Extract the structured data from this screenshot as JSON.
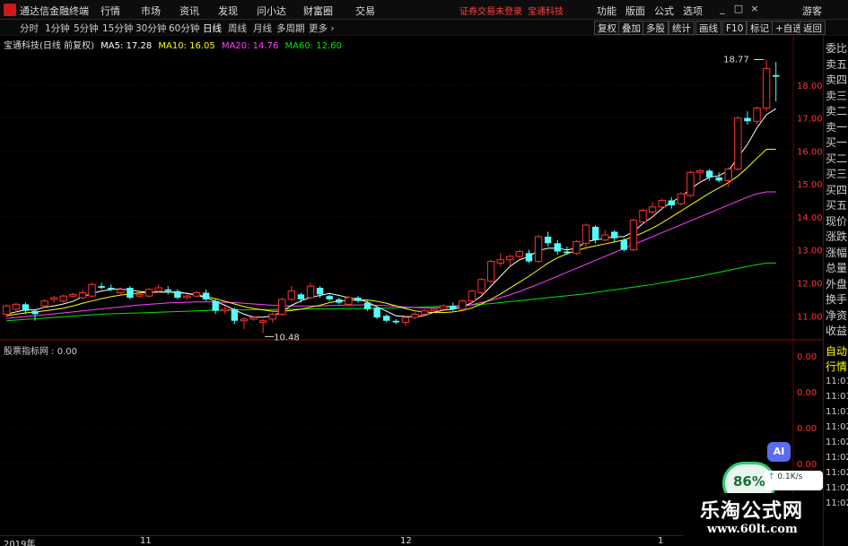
{
  "app": {
    "title": "通达信金融终端",
    "menus": [
      "行情",
      "市场",
      "资讯",
      "发现",
      "问小达",
      "财富圈",
      "交易"
    ],
    "alert": "证券交易未登录",
    "alert_stock": "宝通科技",
    "right_menus": [
      "功能",
      "版面",
      "公式",
      "选项"
    ],
    "user": "游客",
    "window_buttons": [
      "_",
      "□",
      "×"
    ]
  },
  "tabs": [
    "分时",
    "1分钟",
    "5分钟",
    "15分钟",
    "30分钟",
    "60分钟",
    "日线",
    "周线",
    "月线",
    "多周期",
    "更多 ›"
  ],
  "active_tab": "日线",
  "toolbar_right": [
    "复权",
    "叠加",
    "多股",
    "统计",
    "画线",
    "F10",
    "标记",
    "+自选",
    "返回"
  ],
  "legend": {
    "stock": "宝通科技(日线 前复权)",
    "ma5": "MA5: 17.28",
    "ma10": "MA10: 16.05",
    "ma20": "MA20: 14.76",
    "ma60": "MA60: 12.60"
  },
  "colors": {
    "up": "#ff3232",
    "down": "#54fcfc",
    "ma5": "#ffffff",
    "ma10": "#ffff00",
    "ma20": "#ff40ff",
    "ma60": "#00e600",
    "grid": "#700000",
    "axis_text": "#ff3232"
  },
  "price_axis": [
    "18.00",
    "17.00",
    "16.00",
    "15.00",
    "14.00",
    "13.00",
    "12.00",
    "11.00"
  ],
  "annotations": {
    "high": "18.77",
    "low": "10.48"
  },
  "indicator": {
    "legend": "股票指标网 : 0.00",
    "axis": [
      "0.00",
      "0.00",
      "0.00",
      "0.00"
    ]
  },
  "quote_panel": {
    "labels": [
      "委比",
      "卖五",
      "卖四",
      "卖三",
      "卖二",
      "卖一",
      "买一",
      "买二",
      "买三",
      "买四",
      "买五",
      "现价",
      "涨跌",
      "涨幅",
      "总量",
      "外盘",
      "换手",
      "净资",
      "收益"
    ],
    "lower": [
      "自动",
      "行情",
      "11:01",
      "11:01",
      "11:01",
      "11:02",
      "11:02",
      "11:02",
      "11:02",
      "11:02",
      "11:02"
    ]
  },
  "date_axis": [
    "2019年",
    "11",
    "12",
    "1"
  ],
  "widgets": {
    "ai": "AI",
    "pct": "86%",
    "speed": "0.1K/s"
  },
  "watermark": {
    "line1": "乐淘公式网",
    "line2": "www.60lt.com"
  },
  "chart_data": {
    "type": "candlestick",
    "ylim": [
      10.3,
      19.0
    ],
    "yticks": [
      11,
      12,
      13,
      14,
      15,
      16,
      17,
      18
    ],
    "candles": [
      {
        "o": 11.05,
        "c": 11.3,
        "h": 11.35,
        "l": 10.95
      },
      {
        "o": 11.2,
        "c": 11.35,
        "h": 11.4,
        "l": 11.1
      },
      {
        "o": 11.35,
        "c": 11.15,
        "h": 11.4,
        "l": 11.05
      },
      {
        "o": 11.15,
        "c": 11.05,
        "h": 11.2,
        "l": 10.85
      },
      {
        "o": 11.3,
        "c": 11.45,
        "h": 11.5,
        "l": 11.25
      },
      {
        "o": 11.5,
        "c": 11.55,
        "h": 11.6,
        "l": 11.4
      },
      {
        "o": 11.45,
        "c": 11.6,
        "h": 11.65,
        "l": 11.4
      },
      {
        "o": 11.6,
        "c": 11.65,
        "h": 11.7,
        "l": 11.55
      },
      {
        "o": 11.55,
        "c": 11.7,
        "h": 11.8,
        "l": 11.5
      },
      {
        "o": 11.6,
        "c": 11.95,
        "h": 12.0,
        "l": 11.55
      },
      {
        "o": 11.9,
        "c": 11.85,
        "h": 12.0,
        "l": 11.8
      },
      {
        "o": 11.85,
        "c": 11.8,
        "h": 11.95,
        "l": 11.75
      },
      {
        "o": 11.7,
        "c": 11.8,
        "h": 11.85,
        "l": 11.6
      },
      {
        "o": 11.85,
        "c": 11.55,
        "h": 11.9,
        "l": 11.5
      },
      {
        "o": 11.6,
        "c": 11.65,
        "h": 11.7,
        "l": 11.55
      },
      {
        "o": 11.6,
        "c": 11.8,
        "h": 11.85,
        "l": 11.55
      },
      {
        "o": 11.75,
        "c": 11.85,
        "h": 11.95,
        "l": 11.7
      },
      {
        "o": 11.8,
        "c": 11.75,
        "h": 11.9,
        "l": 11.65
      },
      {
        "o": 11.75,
        "c": 11.55,
        "h": 11.8,
        "l": 11.5
      },
      {
        "o": 11.55,
        "c": 11.6,
        "h": 11.65,
        "l": 11.5
      },
      {
        "o": 11.6,
        "c": 11.7,
        "h": 11.75,
        "l": 11.55
      },
      {
        "o": 11.7,
        "c": 11.5,
        "h": 11.8,
        "l": 11.45
      },
      {
        "o": 11.45,
        "c": 11.15,
        "h": 11.5,
        "l": 11.05
      },
      {
        "o": 11.15,
        "c": 11.2,
        "h": 11.3,
        "l": 11.05
      },
      {
        "o": 11.2,
        "c": 10.85,
        "h": 11.25,
        "l": 10.75
      },
      {
        "o": 10.85,
        "c": 10.9,
        "h": 10.95,
        "l": 10.6
      },
      {
        "o": 10.9,
        "c": 10.95,
        "h": 11.0,
        "l": 10.85
      },
      {
        "o": 10.8,
        "c": 10.85,
        "h": 10.9,
        "l": 10.48
      },
      {
        "o": 10.9,
        "c": 11.05,
        "h": 11.1,
        "l": 10.8
      },
      {
        "o": 11.05,
        "c": 11.5,
        "h": 11.55,
        "l": 11.0
      },
      {
        "o": 11.5,
        "c": 11.75,
        "h": 11.9,
        "l": 11.45
      },
      {
        "o": 11.65,
        "c": 11.5,
        "h": 11.7,
        "l": 11.4
      },
      {
        "o": 11.55,
        "c": 11.9,
        "h": 12.0,
        "l": 11.5
      },
      {
        "o": 11.85,
        "c": 11.65,
        "h": 11.9,
        "l": 11.55
      },
      {
        "o": 11.6,
        "c": 11.5,
        "h": 11.65,
        "l": 11.45
      },
      {
        "o": 11.5,
        "c": 11.4,
        "h": 11.55,
        "l": 11.35
      },
      {
        "o": 11.35,
        "c": 11.55,
        "h": 11.6,
        "l": 11.3
      },
      {
        "o": 11.55,
        "c": 11.45,
        "h": 11.6,
        "l": 11.4
      },
      {
        "o": 11.4,
        "c": 11.2,
        "h": 11.45,
        "l": 11.15
      },
      {
        "o": 11.25,
        "c": 10.95,
        "h": 11.3,
        "l": 10.9
      },
      {
        "o": 11.0,
        "c": 10.85,
        "h": 11.05,
        "l": 10.8
      },
      {
        "o": 10.85,
        "c": 10.8,
        "h": 10.9,
        "l": 10.75
      },
      {
        "o": 10.8,
        "c": 10.95,
        "h": 11.0,
        "l": 10.7
      },
      {
        "o": 10.95,
        "c": 11.05,
        "h": 11.1,
        "l": 10.9
      },
      {
        "o": 11.05,
        "c": 11.15,
        "h": 11.2,
        "l": 11.0
      },
      {
        "o": 11.15,
        "c": 11.2,
        "h": 11.25,
        "l": 11.1
      },
      {
        "o": 11.2,
        "c": 11.3,
        "h": 11.35,
        "l": 11.15
      },
      {
        "o": 11.3,
        "c": 11.2,
        "h": 11.4,
        "l": 11.15
      },
      {
        "o": 11.2,
        "c": 11.45,
        "h": 11.5,
        "l": 11.15
      },
      {
        "o": 11.45,
        "c": 11.75,
        "h": 11.8,
        "l": 11.4
      },
      {
        "o": 11.7,
        "c": 12.1,
        "h": 12.15,
        "l": 11.65
      },
      {
        "o": 12.05,
        "c": 12.65,
        "h": 12.7,
        "l": 12.0
      },
      {
        "o": 12.6,
        "c": 12.7,
        "h": 12.9,
        "l": 12.5
      },
      {
        "o": 12.7,
        "c": 12.8,
        "h": 12.85,
        "l": 12.5
      },
      {
        "o": 12.8,
        "c": 12.95,
        "h": 13.0,
        "l": 12.75
      },
      {
        "o": 12.9,
        "c": 12.65,
        "h": 13.0,
        "l": 12.6
      },
      {
        "o": 12.65,
        "c": 13.4,
        "h": 13.45,
        "l": 12.6
      },
      {
        "o": 13.4,
        "c": 13.2,
        "h": 13.55,
        "l": 13.1
      },
      {
        "o": 13.2,
        "c": 12.95,
        "h": 13.3,
        "l": 12.85
      },
      {
        "o": 12.95,
        "c": 12.9,
        "h": 13.1,
        "l": 12.85
      },
      {
        "o": 12.9,
        "c": 13.25,
        "h": 13.3,
        "l": 12.85
      },
      {
        "o": 13.2,
        "c": 13.75,
        "h": 13.8,
        "l": 13.1
      },
      {
        "o": 13.7,
        "c": 13.3,
        "h": 13.75,
        "l": 13.2
      },
      {
        "o": 13.3,
        "c": 13.45,
        "h": 13.6,
        "l": 13.25
      },
      {
        "o": 13.55,
        "c": 13.35,
        "h": 13.6,
        "l": 13.25
      },
      {
        "o": 13.3,
        "c": 13.0,
        "h": 13.35,
        "l": 12.95
      },
      {
        "o": 13.0,
        "c": 13.9,
        "h": 13.95,
        "l": 12.95
      },
      {
        "o": 13.85,
        "c": 14.2,
        "h": 14.25,
        "l": 13.8
      },
      {
        "o": 14.15,
        "c": 14.3,
        "h": 14.45,
        "l": 14.1
      },
      {
        "o": 14.3,
        "c": 14.5,
        "h": 14.55,
        "l": 14.2
      },
      {
        "o": 14.5,
        "c": 14.35,
        "h": 14.6,
        "l": 14.25
      },
      {
        "o": 14.4,
        "c": 14.7,
        "h": 14.75,
        "l": 14.35
      },
      {
        "o": 14.65,
        "c": 15.35,
        "h": 15.4,
        "l": 14.6
      },
      {
        "o": 15.35,
        "c": 15.4,
        "h": 15.45,
        "l": 15.1
      },
      {
        "o": 15.4,
        "c": 15.2,
        "h": 15.45,
        "l": 15.1
      },
      {
        "o": 15.2,
        "c": 15.1,
        "h": 15.35,
        "l": 15.05
      },
      {
        "o": 15.1,
        "c": 15.45,
        "h": 15.5,
        "l": 14.9
      },
      {
        "o": 15.45,
        "c": 17.0,
        "h": 17.05,
        "l": 15.4
      },
      {
        "o": 17.0,
        "c": 16.9,
        "h": 17.2,
        "l": 16.8
      },
      {
        "o": 16.9,
        "c": 17.3,
        "h": 17.35,
        "l": 16.8
      },
      {
        "o": 17.3,
        "c": 18.5,
        "h": 18.77,
        "l": 17.2
      },
      {
        "o": 18.3,
        "c": 18.25,
        "h": 18.7,
        "l": 17.5
      }
    ],
    "ma5": [
      11.05,
      11.12,
      11.18,
      11.18,
      11.26,
      11.3,
      11.36,
      11.44,
      11.58,
      11.68,
      11.75,
      11.8,
      11.82,
      11.78,
      11.74,
      11.71,
      11.72,
      11.72,
      11.72,
      11.68,
      11.62,
      11.55,
      11.44,
      11.32,
      11.18,
      11.05,
      10.96,
      10.96,
      11.0,
      11.12,
      11.32,
      11.45,
      11.56,
      11.62,
      11.68,
      11.62,
      11.55,
      11.5,
      11.42,
      11.27,
      11.14,
      11.0,
      10.98,
      10.97,
      11.01,
      11.11,
      11.17,
      11.2,
      11.27,
      11.4,
      11.6,
      11.9,
      12.2,
      12.5,
      12.7,
      12.8,
      12.98,
      13.05,
      13.05,
      13.0,
      13.05,
      13.25,
      13.3,
      13.35,
      13.4,
      13.4,
      13.55,
      13.8,
      14.0,
      14.25,
      14.45,
      14.6,
      14.85,
      15.05,
      15.2,
      15.25,
      15.4,
      15.8,
      16.2,
      16.7,
      17.1,
      17.28
    ],
    "ma10": [
      11.0,
      11.05,
      11.09,
      11.12,
      11.15,
      11.19,
      11.23,
      11.3,
      11.38,
      11.45,
      11.52,
      11.58,
      11.63,
      11.66,
      11.7,
      11.71,
      11.72,
      11.72,
      11.7,
      11.68,
      11.64,
      11.58,
      11.52,
      11.44,
      11.36,
      11.28,
      11.22,
      11.18,
      11.14,
      11.14,
      11.16,
      11.2,
      11.26,
      11.32,
      11.4,
      11.45,
      11.47,
      11.48,
      11.48,
      11.44,
      11.38,
      11.3,
      11.22,
      11.15,
      11.12,
      11.1,
      11.1,
      11.12,
      11.16,
      11.24,
      11.36,
      11.5,
      11.66,
      11.84,
      12.02,
      12.2,
      12.4,
      12.6,
      12.76,
      12.88,
      12.98,
      13.06,
      13.12,
      13.18,
      13.24,
      13.3,
      13.4,
      13.52,
      13.66,
      13.82,
      14.0,
      14.18,
      14.36,
      14.54,
      14.72,
      14.88,
      15.04,
      15.24,
      15.5,
      15.78,
      16.05,
      16.05
    ],
    "ma20": [
      10.92,
      10.95,
      10.98,
      11.0,
      11.03,
      11.06,
      11.09,
      11.12,
      11.15,
      11.18,
      11.21,
      11.24,
      11.27,
      11.3,
      11.33,
      11.35,
      11.37,
      11.39,
      11.4,
      11.41,
      11.42,
      11.42,
      11.42,
      11.41,
      11.4,
      11.38,
      11.36,
      11.34,
      11.32,
      11.31,
      11.3,
      11.3,
      11.3,
      11.3,
      11.31,
      11.32,
      11.33,
      11.33,
      11.33,
      11.32,
      11.31,
      11.29,
      11.27,
      11.25,
      11.24,
      11.24,
      11.25,
      11.27,
      11.3,
      11.34,
      11.4,
      11.47,
      11.55,
      11.64,
      11.74,
      11.85,
      11.96,
      12.08,
      12.2,
      12.32,
      12.44,
      12.56,
      12.68,
      12.8,
      12.92,
      13.04,
      13.16,
      13.28,
      13.4,
      13.52,
      13.64,
      13.76,
      13.88,
      14.0,
      14.12,
      14.24,
      14.36,
      14.48,
      14.6,
      14.7,
      14.76,
      14.76
    ],
    "ma60": [
      10.85,
      10.87,
      10.89,
      10.91,
      10.93,
      10.95,
      10.97,
      10.99,
      11.01,
      11.03,
      11.05,
      11.06,
      11.07,
      11.08,
      11.09,
      11.1,
      11.11,
      11.12,
      11.13,
      11.14,
      11.15,
      11.16,
      11.17,
      11.17,
      11.18,
      11.18,
      11.19,
      11.19,
      11.19,
      11.2,
      11.2,
      11.2,
      11.21,
      11.21,
      11.21,
      11.22,
      11.22,
      11.22,
      11.23,
      11.23,
      11.23,
      11.24,
      11.25,
      11.26,
      11.27,
      11.28,
      11.29,
      11.3,
      11.31,
      11.33,
      11.35,
      11.37,
      11.4,
      11.43,
      11.46,
      11.49,
      11.52,
      11.55,
      11.58,
      11.61,
      11.64,
      11.67,
      11.71,
      11.75,
      11.79,
      11.83,
      11.87,
      11.91,
      11.95,
      12.0,
      12.05,
      12.1,
      12.15,
      12.2,
      12.26,
      12.32,
      12.38,
      12.44,
      12.5,
      12.55,
      12.6,
      12.6
    ]
  }
}
